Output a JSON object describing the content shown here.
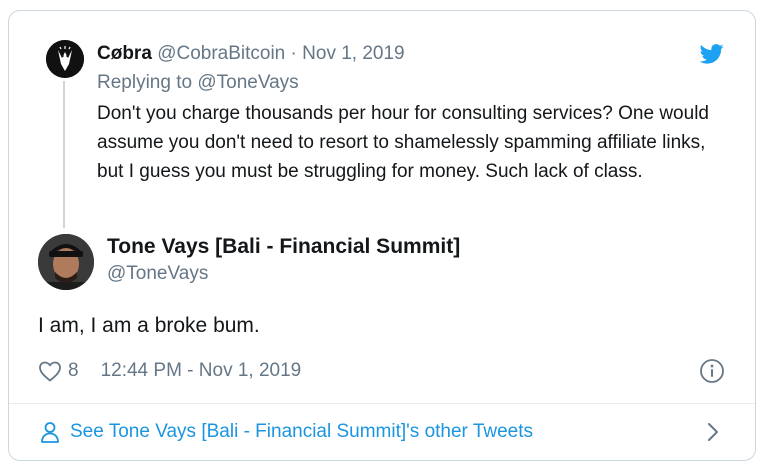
{
  "parent_tweet": {
    "name": "Cøbra",
    "handle": "@CobraBitcoin",
    "separator": "·",
    "date": "Nov 1, 2019",
    "replying_prefix": "Replying to",
    "replying_to": "@ToneVays",
    "text": "Don't you charge thousands per hour for consulting services? One would assume you don't need to resort to shamelessly spamming affiliate links, but I guess you must be struggling for money. Such lack of class."
  },
  "main_tweet": {
    "name": "Tone Vays [Bali - Financial Summit]",
    "handle": "@ToneVays",
    "text": "I am, I am a broke bum.",
    "like_count": "8",
    "timestamp": "12:44 PM - Nov 1, 2019"
  },
  "footer": {
    "link_text": "See Tone Vays [Bali - Financial Summit]'s other Tweets"
  },
  "icons": {
    "brand": "twitter-bird-icon",
    "like": "heart-icon",
    "info": "info-icon",
    "profile": "person-icon",
    "more": "chevron-right-icon"
  },
  "colors": {
    "accent": "#1da1f2",
    "link": "#1b95e0",
    "muted": "#657786",
    "text": "#14171a",
    "border": "#ccd6dd"
  }
}
